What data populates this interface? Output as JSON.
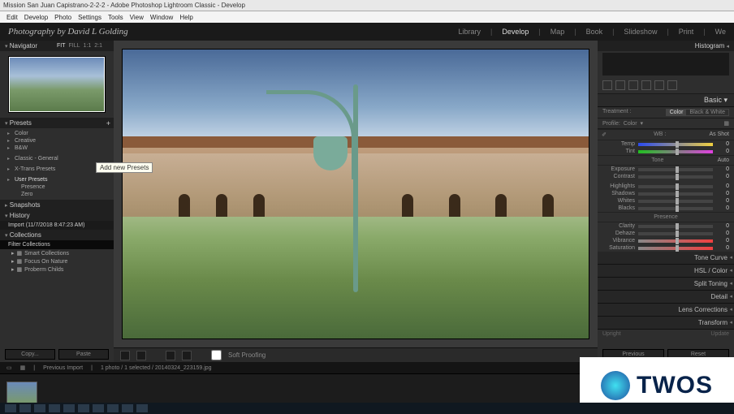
{
  "titlebar": "Mission San Juan Capistrano-2-2-2 - Adobe Photoshop Lightroom Classic - Develop",
  "menu": [
    "Edit",
    "Develop",
    "Photo",
    "Settings",
    "Tools",
    "View",
    "Window",
    "Help"
  ],
  "identity": "Photography by David L Golding",
  "modules": {
    "library": "Library",
    "develop": "Develop",
    "map": "Map",
    "book": "Book",
    "slideshow": "Slideshow",
    "print": "Print",
    "web": "We"
  },
  "navigator": {
    "title": "Navigator",
    "opts": [
      "FIT",
      "FILL",
      "1:1",
      "2:1"
    ]
  },
  "presets": {
    "title": "Presets",
    "groups": [
      "Color",
      "Creative",
      "B&W"
    ],
    "more": [
      "Classic - General",
      "X-Trans Presets"
    ],
    "user": {
      "label": "User Presets",
      "items": [
        "Presence",
        "Zero"
      ]
    }
  },
  "tooltip": "Add new Presets",
  "snapshots": "Snapshots",
  "history": {
    "title": "History",
    "row": "Import (11/7/2018 8:47:23 AM)"
  },
  "collections": {
    "title": "Collections",
    "filter": "Filter Collections",
    "items": [
      "Smart Collections",
      "Focus On Nature",
      "Proberm Childs"
    ]
  },
  "copy": "Copy...",
  "paste": "Paste",
  "softproof": "Soft Proofing",
  "filmstrip_top": {
    "left": "Previous Import",
    "mid": "1 photo / 1 selected / 20140324_223159.jpg"
  },
  "right": {
    "histogram": "Histogram",
    "basic": "Basic",
    "treatment": {
      "label": "Treatment :",
      "color": "Color",
      "bw": "Black & White"
    },
    "profile": {
      "label": "Profile:",
      "value": "Color"
    },
    "wb": {
      "label": "WB :",
      "value": "As Shot"
    },
    "temp": {
      "label": "Temp",
      "val": "0"
    },
    "tint": {
      "label": "Tint",
      "val": "0"
    },
    "tone": {
      "label": "Tone",
      "auto": "Auto"
    },
    "exposure": {
      "label": "Exposure",
      "val": "0"
    },
    "contrast": {
      "label": "Contrast",
      "val": "0"
    },
    "highlights": {
      "label": "Highlights",
      "val": "0"
    },
    "shadows": {
      "label": "Shadows",
      "val": "0"
    },
    "whites": {
      "label": "Whites",
      "val": "0"
    },
    "blacks": {
      "label": "Blacks",
      "val": "0"
    },
    "presence": "Presence",
    "clarity": {
      "label": "Clarity",
      "val": "0"
    },
    "dehaze": {
      "label": "Dehaze",
      "val": "0"
    },
    "vibrance": {
      "label": "Vibrance",
      "val": "0"
    },
    "saturation": {
      "label": "Saturation",
      "val": "0"
    },
    "panels": [
      "Tone Curve",
      "HSL / Color",
      "Split Toning",
      "Detail",
      "Lens Corrections",
      "Transform"
    ],
    "upright": {
      "l": "Upright",
      "r": "Update"
    },
    "previous": "Previous",
    "reset": "Reset"
  },
  "twos": "TWOS"
}
